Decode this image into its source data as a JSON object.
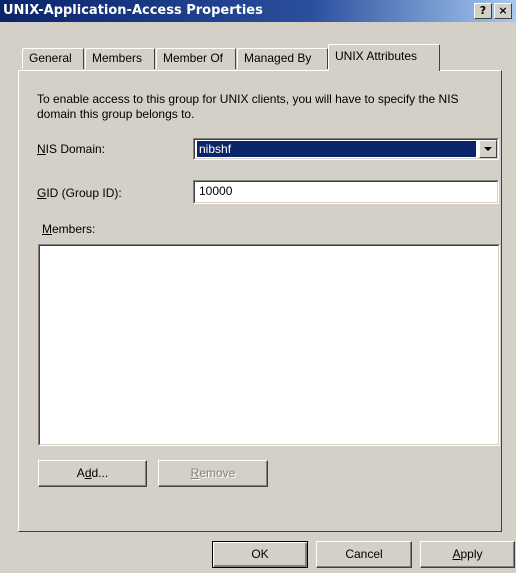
{
  "window": {
    "title": "UNIX-Application-Access Properties",
    "help_label": "?",
    "close_label": "×"
  },
  "tabs": [
    {
      "label": "General"
    },
    {
      "label": "Members"
    },
    {
      "label": "Member Of"
    },
    {
      "label": "Managed By"
    },
    {
      "label": "UNIX Attributes"
    }
  ],
  "active_tab": "UNIX Attributes",
  "content": {
    "description": "To enable access to this group for UNIX clients, you will have to specify the NIS domain this group belongs to.",
    "nis_domain": {
      "label_mnemonic": "N",
      "label_rest": "IS Domain:",
      "value": "nibshf"
    },
    "gid": {
      "label_mnemonic": "G",
      "label_rest": "ID (Group ID):",
      "value": "10000"
    },
    "members": {
      "label_mnemonic": "M",
      "label_rest": "embers:",
      "items": []
    },
    "add_button": {
      "pre": "A",
      "mnemonic": "d",
      "post": "d..."
    },
    "remove_button": {
      "mnemonic": "R",
      "post": "emove"
    }
  },
  "footer": {
    "ok_label": "OK",
    "cancel_label": "Cancel",
    "apply_mnemonic": "A",
    "apply_rest": "pply"
  },
  "colors": {
    "title_bar": "#0a246a",
    "selection": "#0a246a",
    "face": "#d4d0c8"
  }
}
